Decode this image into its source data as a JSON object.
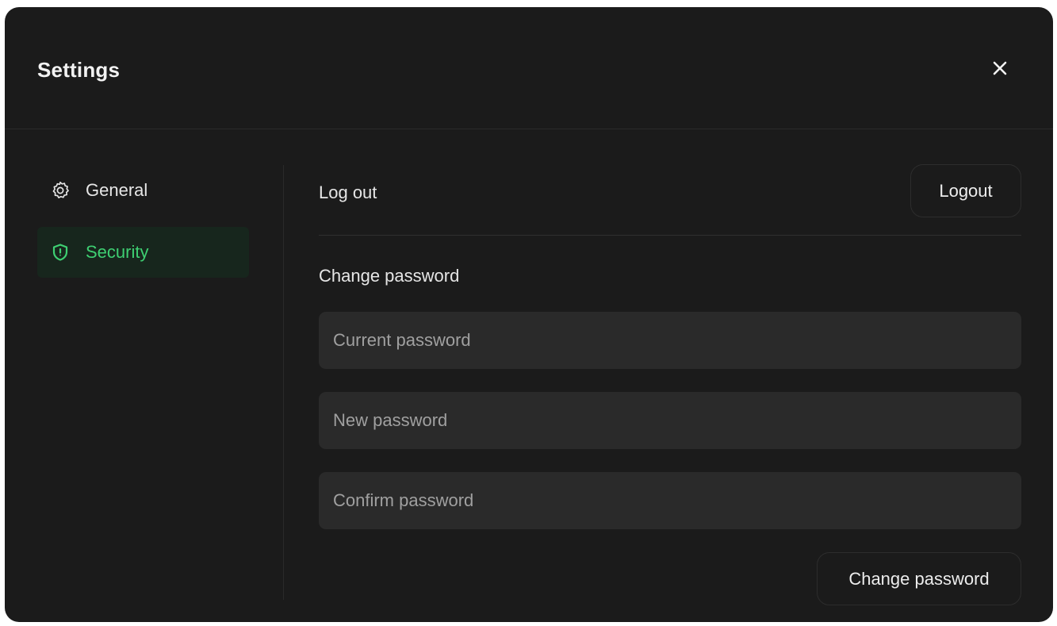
{
  "dialog": {
    "title": "Settings",
    "close_icon": "close-icon"
  },
  "sidebar": {
    "items": [
      {
        "label": "General",
        "icon": "gear-icon",
        "active": false
      },
      {
        "label": "Security",
        "icon": "shield-icon",
        "active": true
      }
    ]
  },
  "security": {
    "logout_label": "Log out",
    "logout_button": "Logout",
    "change_password_title": "Change password",
    "current_password": {
      "placeholder": "Current password",
      "value": ""
    },
    "new_password": {
      "placeholder": "New password",
      "value": ""
    },
    "confirm_password": {
      "placeholder": "Confirm password",
      "value": ""
    },
    "change_password_button": "Change password"
  },
  "colors": {
    "background": "#1b1b1b",
    "accent": "#3ecf72",
    "active_item_bg": "#17261d",
    "field_bg": "#2a2a2a",
    "text": "#e6e6e6",
    "placeholder": "#a0a0a0"
  }
}
